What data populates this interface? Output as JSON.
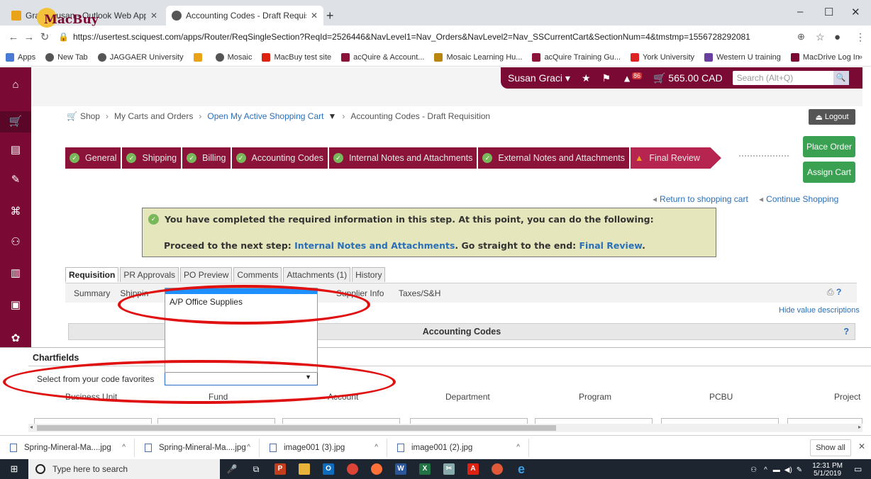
{
  "browser": {
    "tabs": [
      {
        "title": "Graci, Susan - Outlook Web App",
        "active": false
      },
      {
        "title": "Accounting Codes - Draft Requis",
        "active": true
      }
    ],
    "url": "https://usertest.sciquest.com/apps/Router/ReqSingleSection?ReqId=2526446&NavLevel1=Nav_Orders&NavLevel2=Nav_SSCurrentCart&SectionNum=4&tmstmp=1556728292081",
    "bookmarks": [
      "Apps",
      "New Tab",
      "JAGGAER University",
      "",
      "Mosaic",
      "MacBuy test site",
      "acQuire & Account...",
      "Mosaic Learning Hu...",
      "acQuire Training Gu...",
      "York University",
      "Western U training",
      "MacDrive Log In"
    ],
    "bookmark_overflow": "»"
  },
  "app": {
    "logo_text": "MacBuy",
    "user": "Susan Graci ▾",
    "notif_count": "86",
    "cart_total": "565.00 CAD",
    "search_placeholder": "Search (Alt+Q)",
    "logout": "Logout",
    "breadcrumb": [
      "Shop",
      "My Carts and Orders",
      "Open My Active Shopping Cart",
      "Accounting Codes - Draft Requisition"
    ],
    "steps": [
      "General",
      "Shipping",
      "Billing",
      "Accounting Codes",
      "Internal Notes and Attachments",
      "External Notes and Attachments",
      "Final Review"
    ],
    "place_order": "Place Order",
    "assign_cart": "Assign Cart",
    "return_link": "Return to shopping cart",
    "continue_link": "Continue Shopping",
    "notice": {
      "line1": "You have completed the required information in this step. At this point, you can do the following:",
      "line2_prefix": "Proceed to the next step: ",
      "line2_link1": "Internal Notes and Attachments",
      "line2_mid": ". Go straight to the end: ",
      "line2_link2": "Final Review",
      "line2_suffix": "."
    },
    "primary_tabs": [
      "Requisition",
      "PR Approvals",
      "PO Preview",
      "Comments",
      "Attachments (1)",
      "History"
    ],
    "sub_tabs": {
      "summary": "Summary",
      "shipping": "Shippin",
      "supplier": "Supplier Info",
      "taxes": "Taxes/S&H"
    },
    "hide_desc": "Hide value descriptions",
    "accounting_header": "Accounting Codes",
    "help": "?"
  },
  "chartfields": {
    "title": "Chartfields",
    "favorites_label": "Select from your code favorites",
    "favorites_value": "",
    "dropdown_options": [
      "A/P Office Supplies"
    ],
    "columns": [
      "Business Unit",
      "Fund",
      "Account",
      "Department",
      "Program",
      "PCBU",
      "Project"
    ]
  },
  "downloads": {
    "items": [
      "Spring-Mineral-Ma....jpg",
      "Spring-Mineral-Ma....jpg",
      "image001 (3).jpg",
      "image001 (2).jpg"
    ],
    "show_all": "Show all"
  },
  "taskbar": {
    "search_placeholder": "Type here to search",
    "time": "12:31 PM",
    "date": "5/1/2019"
  },
  "colors": {
    "brand": "#7a0a33",
    "link": "#2a6fb8",
    "success": "#3aa052",
    "highlight": "#e01010"
  }
}
